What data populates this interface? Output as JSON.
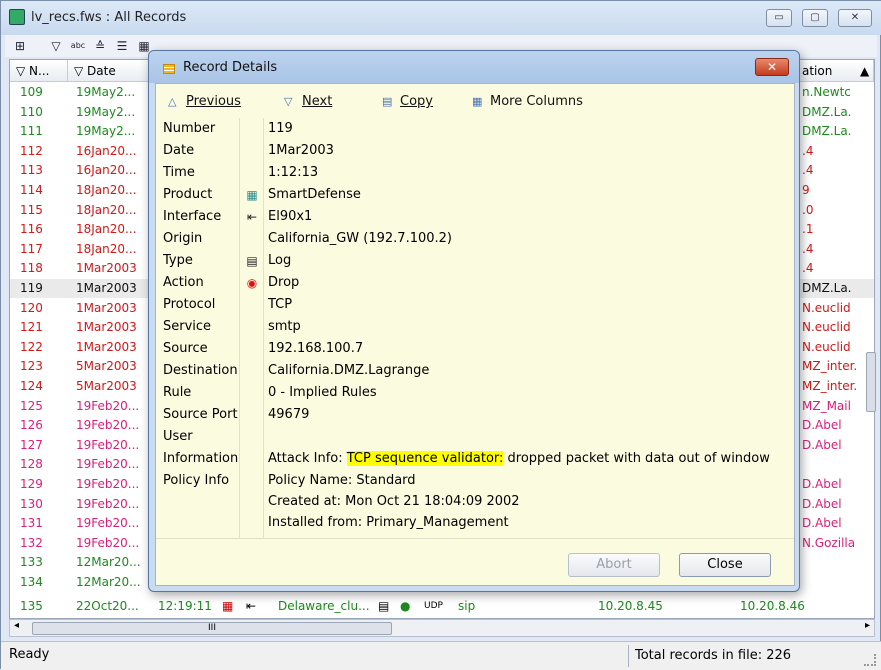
{
  "window": {
    "title": "lv_recs.fws : All Records",
    "min": "▭",
    "max": "▢",
    "close": "✕"
  },
  "toolbar": {
    "icons": [
      "grid-icon",
      "filter-icon",
      "abc-icon",
      "find-icon",
      "list-icon",
      "table-icon",
      "export-icon",
      "clear-filter-icon",
      "search-binoculars-icon",
      "goto-top-icon",
      "goto-bottom-icon",
      "window-icon",
      "panel-icon"
    ]
  },
  "columns": {
    "no": "N...",
    "date": "Date",
    "dest": "ation"
  },
  "rows": [
    {
      "no": "109",
      "date": "19May2...",
      "dest": "n.Newtc",
      "color": "green"
    },
    {
      "no": "110",
      "date": "19May2...",
      "dest": "DMZ.La.",
      "color": "green"
    },
    {
      "no": "111",
      "date": "19May2...",
      "dest": "DMZ.La.",
      "color": "green"
    },
    {
      "no": "112",
      "date": "16Jan20...",
      "dest": ".4",
      "color": "red"
    },
    {
      "no": "113",
      "date": "16Jan20...",
      "dest": ".4",
      "color": "red"
    },
    {
      "no": "114",
      "date": "18Jan20...",
      "dest": "9",
      "color": "red"
    },
    {
      "no": "115",
      "date": "18Jan20...",
      "dest": ".0",
      "color": "red"
    },
    {
      "no": "116",
      "date": "18Jan20...",
      "dest": ".1",
      "color": "red"
    },
    {
      "no": "117",
      "date": "18Jan20...",
      "dest": ".4",
      "color": "red"
    },
    {
      "no": "118",
      "date": "1Mar2003",
      "dest": ".4",
      "color": "red"
    },
    {
      "no": "119",
      "date": "1Mar2003",
      "dest": "DMZ.La.",
      "color": "black"
    },
    {
      "no": "120",
      "date": "1Mar2003",
      "dest": "N.euclid",
      "color": "red"
    },
    {
      "no": "121",
      "date": "1Mar2003",
      "dest": "N.euclid",
      "color": "red"
    },
    {
      "no": "122",
      "date": "1Mar2003",
      "dest": "N.euclid",
      "color": "red"
    },
    {
      "no": "123",
      "date": "5Mar2003",
      "dest": "MZ_inter.",
      "color": "red"
    },
    {
      "no": "124",
      "date": "5Mar2003",
      "dest": "MZ_inter.",
      "color": "red"
    },
    {
      "no": "125",
      "date": "19Feb20...",
      "dest": "MZ_Mail",
      "color": "pink"
    },
    {
      "no": "126",
      "date": "19Feb20...",
      "dest": "D.Abel",
      "color": "pink"
    },
    {
      "no": "127",
      "date": "19Feb20...",
      "dest": "D.Abel",
      "color": "pink"
    },
    {
      "no": "128",
      "date": "19Feb20...",
      "dest": "",
      "color": "pink"
    },
    {
      "no": "129",
      "date": "19Feb20...",
      "dest": "D.Abel",
      "color": "pink"
    },
    {
      "no": "130",
      "date": "19Feb20...",
      "dest": "D.Abel",
      "color": "pink"
    },
    {
      "no": "131",
      "date": "19Feb20...",
      "dest": "D.Abel",
      "color": "pink"
    },
    {
      "no": "132",
      "date": "19Feb20...",
      "dest": "N.Gozilla",
      "color": "pink"
    },
    {
      "no": "133",
      "date": "12Mar20...",
      "dest": "",
      "color": "green"
    },
    {
      "no": "134",
      "date": "12Mar20...",
      "dest": "",
      "color": "green"
    }
  ],
  "last_row": {
    "no": "135",
    "date": "22Oct20...",
    "time": "12:19:11",
    "origin": "Delaware_clu...",
    "service": "sip",
    "source": "10.20.8.45",
    "dest": "10.20.8.46",
    "proto": "UDP"
  },
  "hscroll_label": "III",
  "status": {
    "left": "Ready",
    "right": "Total records in file: 226"
  },
  "dialog": {
    "title": "Record Details",
    "close": "✕",
    "nav": {
      "prev": "Previous",
      "next": "Next",
      "copy": "Copy",
      "more": "More Columns"
    },
    "fields": [
      {
        "label": "Number",
        "value": "119",
        "icon": ""
      },
      {
        "label": "Date",
        "value": "1Mar2003",
        "icon": ""
      },
      {
        "label": "Time",
        "value": "1:12:13",
        "icon": ""
      },
      {
        "label": "Product",
        "value": "SmartDefense",
        "icon": "smartdefense-icon"
      },
      {
        "label": "Interface",
        "value": "El90x1",
        "icon": "interface-icon"
      },
      {
        "label": "Origin",
        "value": "California_GW (192.7.100.2)",
        "icon": ""
      },
      {
        "label": "Type",
        "value": "Log",
        "icon": "log-icon"
      },
      {
        "label": "Action",
        "value": "Drop",
        "icon": "drop-icon"
      },
      {
        "label": "Protocol",
        "value": "TCP",
        "icon": ""
      },
      {
        "label": "Service",
        "value": "smtp",
        "icon": ""
      },
      {
        "label": "Source",
        "value": "192.168.100.7",
        "icon": ""
      },
      {
        "label": "Destination",
        "value": "California.DMZ.Lagrange",
        "icon": ""
      },
      {
        "label": "Rule",
        "value": "0 - Implied Rules",
        "icon": ""
      },
      {
        "label": "Source Port",
        "value": "49679",
        "icon": ""
      },
      {
        "label": "User",
        "value": "",
        "icon": ""
      }
    ],
    "information": {
      "label": "Information",
      "prefix": "Attack Info: ",
      "highlight": "TCP sequence validator:",
      "suffix": " dropped packet with data out of window"
    },
    "policy": {
      "label": "Policy Info",
      "lines": [
        "Policy Name: Standard",
        "Created at: Mon Oct 21 18:04:09 2002",
        "Installed from: Primary_Management"
      ]
    },
    "buttons": {
      "abort": "Abort",
      "close": "Close"
    }
  }
}
